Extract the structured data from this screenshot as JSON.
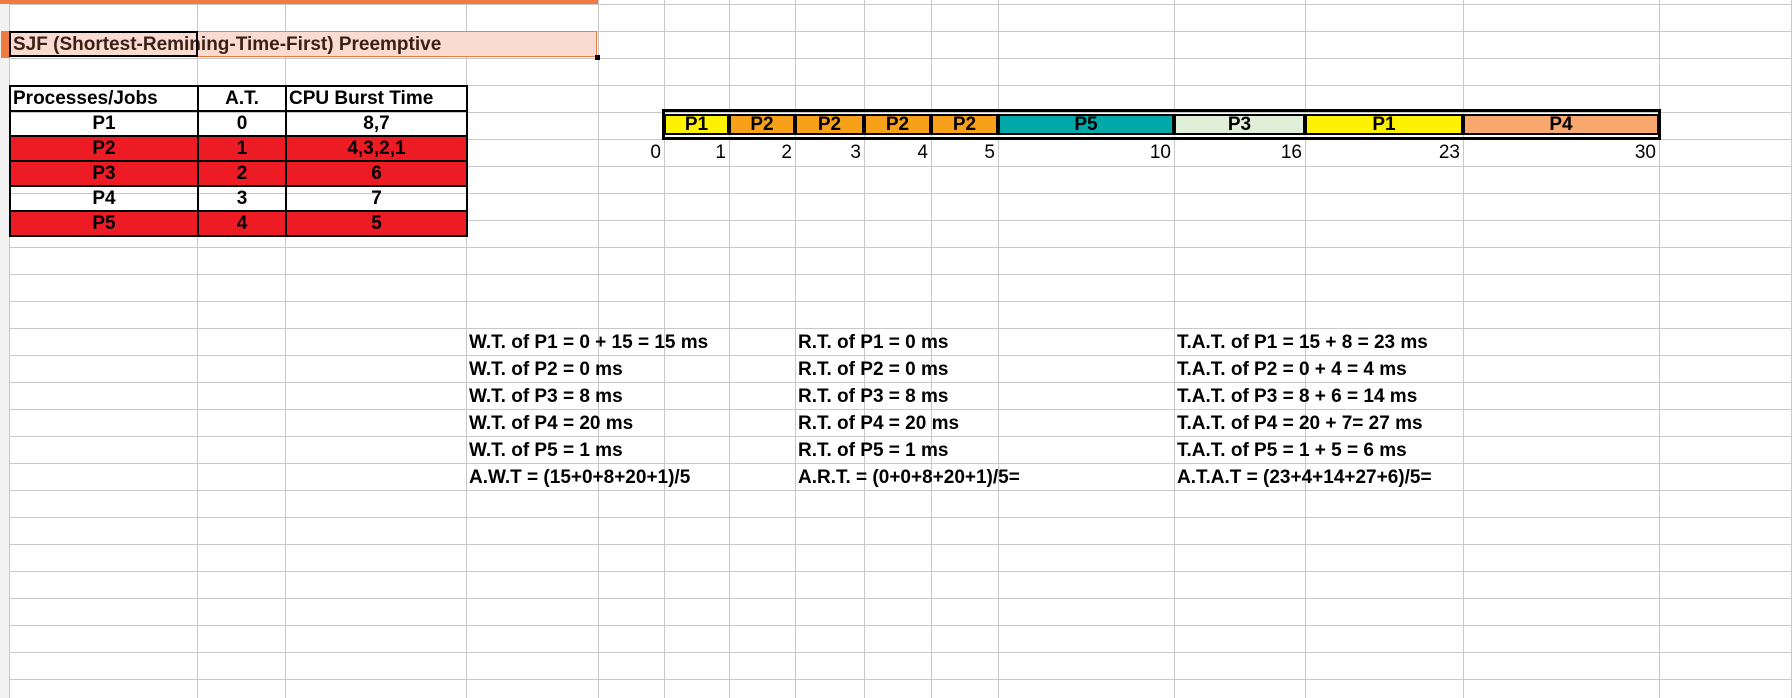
{
  "sheet": {
    "title": "SJF (Shortest-Remining-Time-First) Preemptive",
    "accent_color": "#f07b40",
    "title_bg": "#fadbd2"
  },
  "process_table": {
    "headers": [
      "Processes/Jobs",
      "A.T.",
      "CPU Burst Time"
    ],
    "rows": [
      {
        "process": "P1",
        "arrival": "0",
        "burst": "8,7",
        "highlight": false
      },
      {
        "process": "P2",
        "arrival": "1",
        "burst": "4,3,2,1",
        "highlight": true
      },
      {
        "process": "P3",
        "arrival": "2",
        "burst": "6",
        "highlight": true
      },
      {
        "process": "P4",
        "arrival": "3",
        "burst": "7",
        "highlight": false
      },
      {
        "process": "P5",
        "arrival": "4",
        "burst": "5",
        "highlight": true
      }
    ],
    "highlight_color": "#ed1c24"
  },
  "gantt": {
    "start": "0",
    "segments": [
      {
        "label": "P1",
        "end": "1",
        "color": "#fff200"
      },
      {
        "label": "P2",
        "end": "2",
        "color": "#f7a11a"
      },
      {
        "label": "P2",
        "end": "3",
        "color": "#f7a11a"
      },
      {
        "label": "P2",
        "end": "4",
        "color": "#f7a11a"
      },
      {
        "label": "P2",
        "end": "5",
        "color": "#f7a11a"
      },
      {
        "label": "P5",
        "end": "10",
        "color": "#00a8aa"
      },
      {
        "label": "P3",
        "end": "16",
        "color": "#e1eed8"
      },
      {
        "label": "P1",
        "end": "23",
        "color": "#fff200"
      },
      {
        "label": "P4",
        "end": "30",
        "color": "#f8a86f"
      }
    ]
  },
  "calculations": {
    "waiting_time": [
      "W.T. of P1 = 0 + 15 = 15 ms",
      "W.T. of P2 = 0 ms",
      "W.T. of P3 = 8 ms",
      "W.T. of P4 = 20 ms",
      "W.T. of P5 = 1 ms",
      "A.W.T = (15+0+8+20+1)/5"
    ],
    "response_time": [
      "R.T. of P1 = 0 ms",
      "R.T. of P2 = 0 ms",
      "R.T. of P3 = 8 ms",
      "R.T. of P4 = 20 ms",
      "R.T. of P5 = 1 ms",
      "A.R.T. = (0+0+8+20+1)/5="
    ],
    "turnaround_time": [
      "T.A.T. of P1 = 15 + 8 = 23 ms",
      "T.A.T. of P2 = 0 + 4 = 4 ms",
      "T.A.T. of P3 = 8 + 6 = 14 ms",
      "T.A.T. of P4 = 20 + 7= 27 ms",
      "T.A.T. of P5 = 1 + 5 = 6 ms",
      "A.T.A.T = (23+4+14+27+6)/5="
    ]
  }
}
